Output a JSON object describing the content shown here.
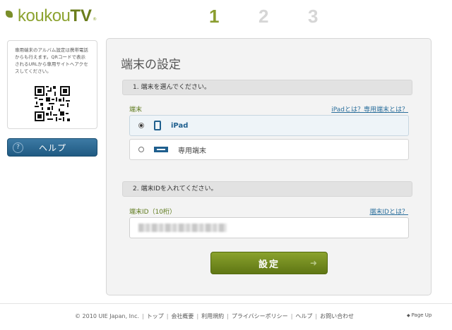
{
  "header": {
    "logo_main": "koukou",
    "logo_tv": "TV",
    "logo_reg": "®",
    "steps": [
      "1",
      "2",
      "3"
    ]
  },
  "sidebar": {
    "info_text": "専用端末のアルバム設定は携帯電話からも行えます。QRコードで表示されるURLから専用サイトへアクセスしてください。",
    "help_label": "ヘルプ",
    "help_icon": "?"
  },
  "main": {
    "title": "端末の設定",
    "section1": {
      "heading": "1. 端末を選んでください。",
      "field_label": "端末",
      "link": "iPadとは？専用端末とは？",
      "options": [
        {
          "label": "iPad",
          "selected": true
        },
        {
          "label": "専用端末",
          "selected": false
        }
      ]
    },
    "section2": {
      "heading": "2. 端末IDを入れてください。",
      "field_label": "端末ID（10桁）",
      "link": "端末IDとは？"
    },
    "submit_label": "設定",
    "submit_arrow": "➜"
  },
  "footer": {
    "copyright": "© 2010 UIE Japan, Inc.",
    "links": [
      "トップ",
      "会社概要",
      "利用規約",
      "プライバシーポリシー",
      "ヘルプ",
      "お問い合わせ"
    ],
    "page_up": "Page Up",
    "page_up_icon": "◆"
  },
  "colors": {
    "brand_green": "#8da331",
    "button_blue": "#1f5a82",
    "link_blue": "#2b6f9c"
  }
}
